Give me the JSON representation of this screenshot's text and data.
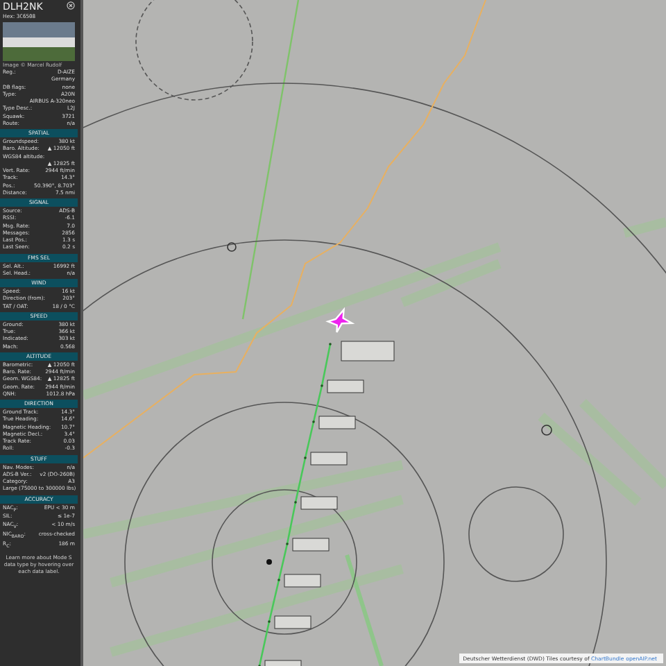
{
  "aircraft": {
    "callsign": "DLH2NK",
    "hex_label": "Hex:",
    "hex": "3C6508",
    "photo_credit": "Image © Marcel Rudolf"
  },
  "sections": [
    {
      "rows": [
        {
          "label": "Reg.:",
          "value": "D-AIZE"
        },
        {
          "value": "Germany"
        },
        {
          "label": "DB flags:",
          "value": "none"
        },
        {
          "label": "Type:",
          "value": "A20N"
        },
        {
          "value": "AIRBUS A-320neo"
        },
        {
          "label": "Type Desc.:",
          "value": "L2J"
        },
        {
          "label": "Squawk:",
          "value": "3721"
        },
        {
          "label": "Route:",
          "value": "n/a"
        }
      ]
    },
    {
      "title": "SPATIAL",
      "rows": [
        {
          "label": "Groundspeed:",
          "value": "380 kt"
        },
        {
          "label": "Baro. Altitude:",
          "value": "▲ 12050 ft"
        },
        {
          "label": "WGS84 altitude:"
        },
        {
          "value": "▲ 12825 ft"
        },
        {
          "label": "Vert. Rate:",
          "value": "2944 ft/min"
        },
        {
          "label": "Track:",
          "value": "14.3°"
        },
        {
          "label": "Pos.:",
          "value": "50.390°, 8.703°"
        },
        {
          "label": "Distance:",
          "value": "7.5 nmi"
        }
      ]
    },
    {
      "title": "SIGNAL",
      "rows": [
        {
          "label": "Source:",
          "value": "ADS-B"
        },
        {
          "label": "RSSI:",
          "value": "-6.1"
        },
        {
          "label": "Msg. Rate:",
          "value": "7.0"
        },
        {
          "label": "Messages:",
          "value": "2856"
        },
        {
          "label": "Last Pos.:",
          "value": "1.3 s"
        },
        {
          "label": "Last Seen:",
          "value": "0.2 s"
        }
      ]
    },
    {
      "title": "FMS SEL",
      "rows": [
        {
          "label": "Sel. Alt.:",
          "value": "16992 ft"
        },
        {
          "label": "Sel. Head.:",
          "value": "n/a"
        }
      ]
    },
    {
      "title": "WIND",
      "rows": [
        {
          "label": "Speed:",
          "value": "16 kt"
        },
        {
          "label": "Direction (from):",
          "value": "203°"
        },
        {
          "label": "TAT / OAT:",
          "value": "18 / 0 °C"
        }
      ]
    },
    {
      "title": "SPEED",
      "rows": [
        {
          "label": "Ground:",
          "value": "380 kt"
        },
        {
          "label": "True:",
          "value": "366 kt"
        },
        {
          "label": "Indicated:",
          "value": "303 kt"
        },
        {
          "label": "Mach:",
          "value": "0.568"
        }
      ]
    },
    {
      "title": "ALTITUDE",
      "rows": [
        {
          "label": "Barometric:",
          "value": "▲ 12050 ft"
        },
        {
          "label": "Baro. Rate:",
          "value": "2944 ft/min"
        },
        {
          "label": "Geom. WGS84:",
          "value": "▲ 12825 ft"
        },
        {
          "label": "Geom. Rate:",
          "value": "2944 ft/min"
        },
        {
          "label": "QNH:",
          "value": "1012.8 hPa"
        }
      ]
    },
    {
      "title": "DIRECTION",
      "rows": [
        {
          "label": "Ground Track:",
          "value": "14.3°"
        },
        {
          "label": "True Heading:",
          "value": "14.6°"
        },
        {
          "label": "Magnetic Heading:",
          "value": "10.7°"
        },
        {
          "label": "Magnetic Decl.:",
          "value": "3.4°"
        },
        {
          "label": "Track Rate:",
          "value": "0.03"
        },
        {
          "label": "Roll:",
          "value": "-0.3"
        }
      ]
    },
    {
      "title": "STUFF",
      "rows": [
        {
          "label": "Nav. Modes:",
          "value": "n/a"
        },
        {
          "label": "ADS-B Ver.:",
          "value": "v2 (DO-260B)"
        },
        {
          "label": "Category:",
          "value": "A3"
        },
        {
          "label": "Large (75000 to 300000 lbs)"
        }
      ]
    },
    {
      "title": "ACCURACY",
      "rows": [
        {
          "label": "NAC$_{P}$:",
          "value": "EPU < 30 m"
        },
        {
          "label": "SIL:",
          "value": "≤ 1e-7"
        },
        {
          "label": "NAC$_{V}$:",
          "value": "< 10 m/s"
        },
        {
          "label": "NIC$_{BARO}$:",
          "value": "cross-checked"
        },
        {
          "label": "R$_{C}$:",
          "value": "186 m"
        }
      ]
    }
  ],
  "footer_note": "Learn more about Mode S data type by hovering over each data label.",
  "attribution": {
    "text": "Deutscher Wetterdienst (DWD) Tiles courtesy of",
    "links": [
      "ChartBundle",
      "openAIP.net"
    ]
  }
}
